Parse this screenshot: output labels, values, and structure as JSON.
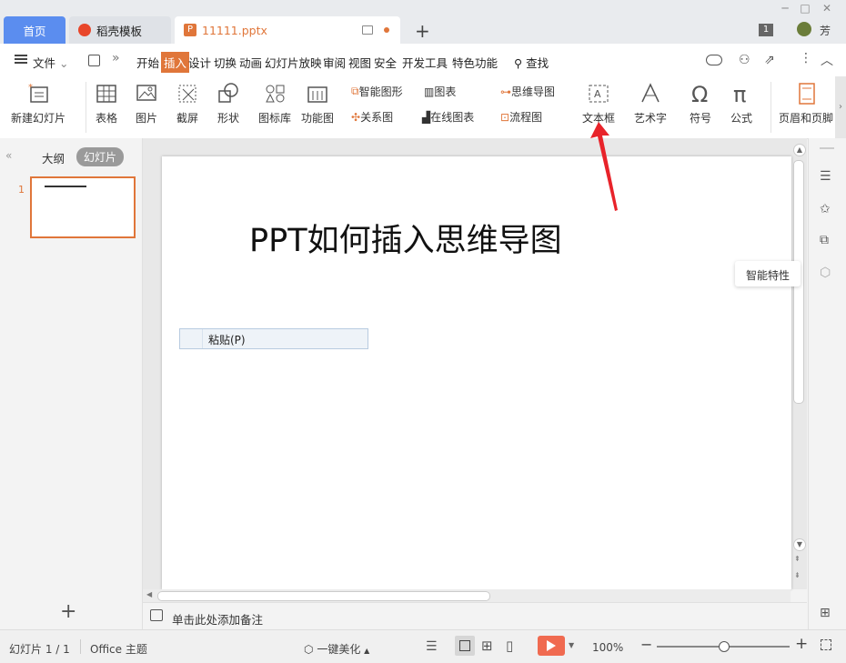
{
  "tabs": {
    "home": "首页",
    "docer": "稻壳模板",
    "file": "11111.pptx",
    "user_badge": "1",
    "user_name": "芳"
  },
  "menu": {
    "file": "文件",
    "items": [
      "开始",
      "插入",
      "设计",
      "切换",
      "动画",
      "幻灯片放映",
      "审阅",
      "视图",
      "安全",
      "开发工具",
      "特色功能"
    ],
    "active_index": 1,
    "search": "查找"
  },
  "ribbon": {
    "new_slide": "新建幻灯片",
    "table": "表格",
    "picture": "图片",
    "screenshot": "截屏",
    "shape": "形状",
    "icon_lib": "图标库",
    "function_chart": "功能图",
    "smart_art": "智能图形",
    "chart": "图表",
    "relation": "关系图",
    "online_chart": "在线图表",
    "mind_map": "思维导图",
    "flow_chart": "流程图",
    "text_box": "文本框",
    "word_art": "艺术字",
    "symbol": "符号",
    "formula": "公式",
    "header_footer": "页眉和页脚"
  },
  "left_panel": {
    "outline_tab": "大纲",
    "slides_tab": "幻灯片",
    "slide_number": "1"
  },
  "slide": {
    "title": "PPT如何插入思维导图",
    "paste_menu": "粘贴(P)"
  },
  "tooltip": {
    "smart_feature": "智能特性"
  },
  "notes": {
    "placeholder": "单击此处添加备注"
  },
  "status": {
    "slide_info": "幻灯片 1 / 1",
    "theme": "Office 主题",
    "beautify": "一键美化",
    "zoom": "100%"
  },
  "colors": {
    "accent": "#e0763a",
    "home_tab": "#5b8def",
    "arrow": "#e8232a"
  }
}
